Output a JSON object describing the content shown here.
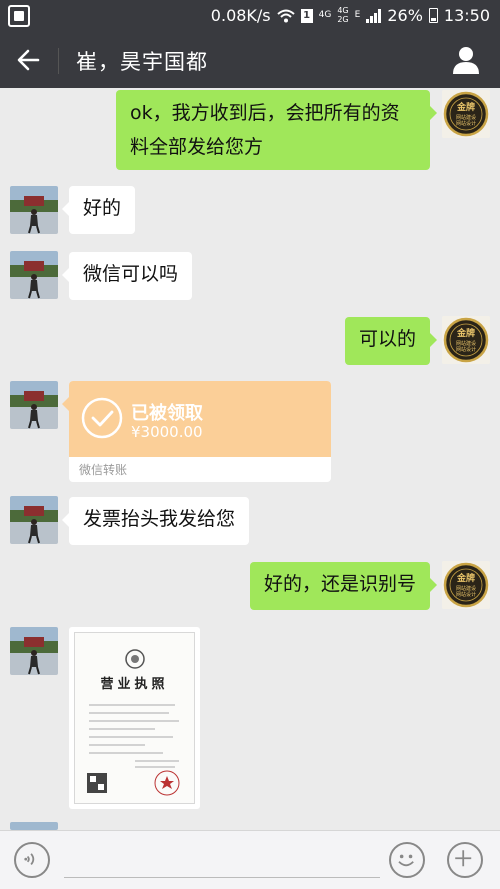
{
  "status_bar": {
    "speed": "0.08K/s",
    "net_4g": "4G",
    "net_4g2g_a": "4G",
    "net_4g2g_b": "2G",
    "net_e": "E",
    "battery": "26%",
    "time": "13:50"
  },
  "header": {
    "title": "崔，昊宇国都"
  },
  "messages": [
    {
      "side": "right",
      "type": "text",
      "text_line1": "ok，我方收到后，会把所有的资",
      "text_line2": "料全部发给您方"
    },
    {
      "side": "left",
      "type": "text",
      "text": "好的"
    },
    {
      "side": "left",
      "type": "text",
      "text": "微信可以吗"
    },
    {
      "side": "right",
      "type": "text",
      "text": "可以的"
    },
    {
      "side": "left",
      "type": "transfer",
      "status": "已被领取",
      "amount": "¥3000.00",
      "label": "微信转账"
    },
    {
      "side": "left",
      "type": "text",
      "text": "发票抬头我发给您"
    },
    {
      "side": "right",
      "type": "text",
      "text": "好的，还是识别号"
    },
    {
      "side": "left",
      "type": "image",
      "image_title": "营业执照"
    }
  ],
  "brand_avatar": {
    "line1": "金牌",
    "line2": "网站建设",
    "line3": "网站设计"
  },
  "input_bar": {
    "placeholder": ""
  },
  "colors": {
    "header_bg": "#393a3f",
    "chat_bg": "#ebebeb",
    "green_bubble": "#a0e75a",
    "transfer_orange": "#fbcf98"
  }
}
